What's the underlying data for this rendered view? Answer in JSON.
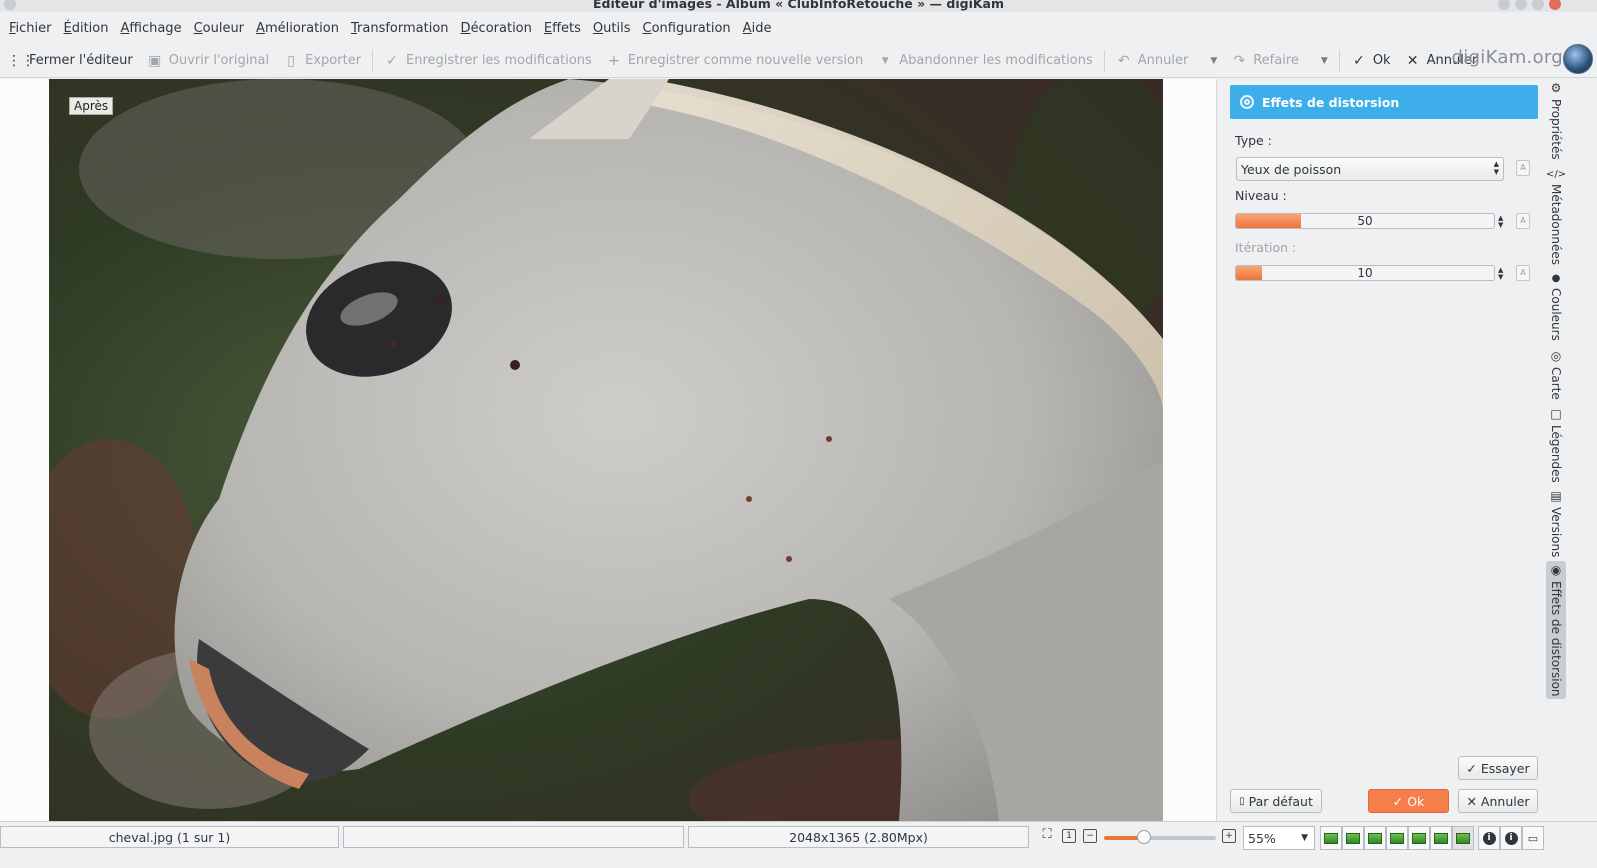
{
  "window": {
    "title": "Editeur d'images - Album « ClubInfoRetouche » — digiKam"
  },
  "menu": [
    {
      "pre": "",
      "ul": "F",
      "post": "ichier"
    },
    {
      "pre": "",
      "ul": "É",
      "post": "dition"
    },
    {
      "pre": "",
      "ul": "A",
      "post": "ffichage"
    },
    {
      "pre": "",
      "ul": "C",
      "post": "ouleur"
    },
    {
      "pre": "",
      "ul": "A",
      "post": "mélioration"
    },
    {
      "pre": "",
      "ul": "T",
      "post": "ransformation"
    },
    {
      "pre": "",
      "ul": "D",
      "post": "écoration"
    },
    {
      "pre": "",
      "ul": "E",
      "post": "ffets"
    },
    {
      "pre": "",
      "ul": "O",
      "post": "utils"
    },
    {
      "pre": "",
      "ul": "C",
      "post": "onfiguration"
    },
    {
      "pre": "",
      "ul": "A",
      "post": "ide"
    }
  ],
  "toolbar": {
    "close_editor": "Fermer l'éditeur",
    "open_original": "Ouvrir l'original",
    "export": "Exporter",
    "save_changes": "Enregistrer les modifications",
    "save_new_version": "Enregistrer comme nouvelle version",
    "discard_changes": "Abandonner les modifications",
    "undo": "Annuler",
    "redo": "Refaire",
    "ok": "Ok",
    "cancel": "Annuler",
    "brand": "digiKam.org"
  },
  "canvas": {
    "after_label": "Après"
  },
  "panel": {
    "title": "Effets de distorsion",
    "type_label": "Type :",
    "type_value": "Yeux de poisson",
    "level_label": "Niveau :",
    "level_value": "50",
    "level_fraction": 0.25,
    "iteration_label": "Itération :",
    "iteration_value": "10",
    "iteration_fraction": 0.1,
    "try_button": "Essayer",
    "default_button": "Par défaut",
    "ok_button": "Ok",
    "cancel_button": "Annuler"
  },
  "sidetabs": [
    {
      "label": "Propriétés",
      "icon": "gear-icon",
      "glyph": "⚙"
    },
    {
      "label": "Métadonnées",
      "icon": "code-icon",
      "glyph": "</>"
    },
    {
      "label": "Couleurs",
      "icon": "drop-icon",
      "glyph": "●"
    },
    {
      "label": "Carte",
      "icon": "globe-icon",
      "glyph": "◎"
    },
    {
      "label": "Légendes",
      "icon": "caption-icon",
      "glyph": "□"
    },
    {
      "label": "Versions",
      "icon": "versions-icon",
      "glyph": "▤"
    },
    {
      "label": "Effets de distorsion",
      "icon": "distortion-icon",
      "glyph": "◉"
    }
  ],
  "status": {
    "filename": "cheval.jpg (1 sur 1)",
    "dimensions": "2048x1365 (2.80Mpx)",
    "zoom": "55%",
    "zoom_fraction": 0.36
  },
  "colors": {
    "accent": "#3daee9",
    "slider_fill": "#f0733a",
    "ok_button": "#f67e4a"
  }
}
